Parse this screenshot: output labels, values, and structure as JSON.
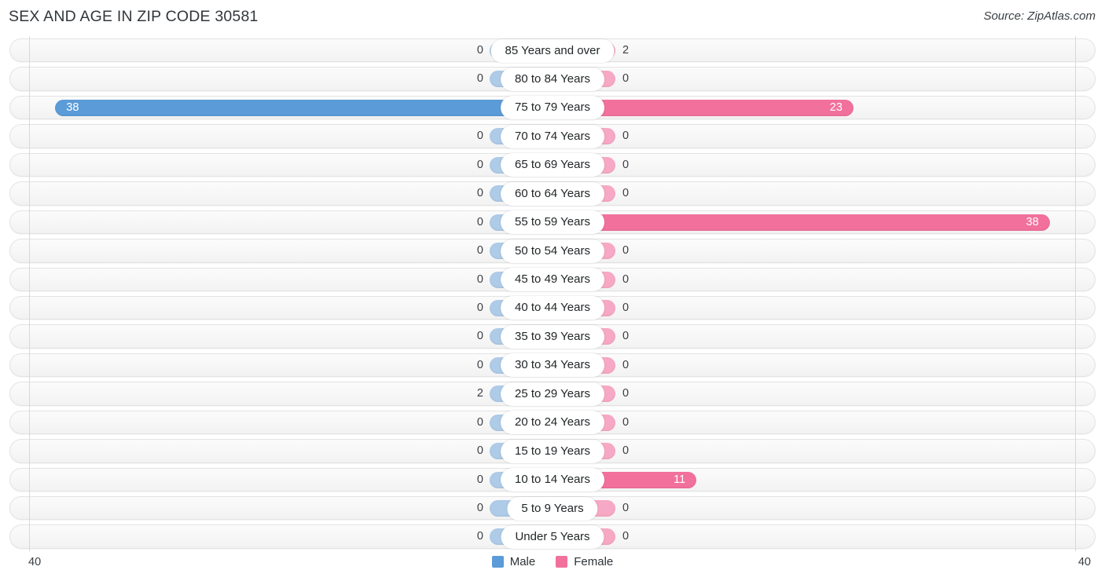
{
  "header": {
    "title": "SEX AND AGE IN ZIP CODE 30581",
    "source": "Source: ZipAtlas.com"
  },
  "legend": {
    "male_label": "Male",
    "female_label": "Female",
    "male_color": "#5b9bd8",
    "female_color": "#f2709c",
    "male_color_light": "#aecbe8",
    "female_color_light": "#f7a8c4"
  },
  "axis": {
    "left_label": "40",
    "right_label": "40",
    "max": 40
  },
  "chart_data": {
    "type": "bar",
    "subtype": "population-pyramid",
    "title": "SEX AND AGE IN ZIP CODE 30581",
    "xlabel": "",
    "ylabel": "",
    "xlim": [
      40,
      40
    ],
    "grid": false,
    "legend_position": "bottom-center",
    "categories": [
      "85 Years and over",
      "80 to 84 Years",
      "75 to 79 Years",
      "70 to 74 Years",
      "65 to 69 Years",
      "60 to 64 Years",
      "55 to 59 Years",
      "50 to 54 Years",
      "45 to 49 Years",
      "40 to 44 Years",
      "35 to 39 Years",
      "30 to 34 Years",
      "25 to 29 Years",
      "20 to 24 Years",
      "15 to 19 Years",
      "10 to 14 Years",
      "5 to 9 Years",
      "Under 5 Years"
    ],
    "series": [
      {
        "name": "Male",
        "values": [
          0,
          0,
          38,
          0,
          0,
          0,
          0,
          0,
          0,
          0,
          0,
          0,
          2,
          0,
          0,
          0,
          0,
          0
        ]
      },
      {
        "name": "Female",
        "values": [
          2,
          0,
          23,
          0,
          0,
          0,
          38,
          0,
          0,
          0,
          0,
          0,
          0,
          0,
          0,
          11,
          0,
          0
        ]
      }
    ]
  },
  "rows": [
    {
      "category": "85 Years and over",
      "male": "0",
      "female": "2"
    },
    {
      "category": "80 to 84 Years",
      "male": "0",
      "female": "0"
    },
    {
      "category": "75 to 79 Years",
      "male": "38",
      "female": "23"
    },
    {
      "category": "70 to 74 Years",
      "male": "0",
      "female": "0"
    },
    {
      "category": "65 to 69 Years",
      "male": "0",
      "female": "0"
    },
    {
      "category": "60 to 64 Years",
      "male": "0",
      "female": "0"
    },
    {
      "category": "55 to 59 Years",
      "male": "0",
      "female": "38"
    },
    {
      "category": "50 to 54 Years",
      "male": "0",
      "female": "0"
    },
    {
      "category": "45 to 49 Years",
      "male": "0",
      "female": "0"
    },
    {
      "category": "40 to 44 Years",
      "male": "0",
      "female": "0"
    },
    {
      "category": "35 to 39 Years",
      "male": "0",
      "female": "0"
    },
    {
      "category": "30 to 34 Years",
      "male": "0",
      "female": "0"
    },
    {
      "category": "25 to 29 Years",
      "male": "2",
      "female": "0"
    },
    {
      "category": "20 to 24 Years",
      "male": "0",
      "female": "0"
    },
    {
      "category": "15 to 19 Years",
      "male": "0",
      "female": "0"
    },
    {
      "category": "10 to 14 Years",
      "male": "0",
      "female": "11"
    },
    {
      "category": "5 to 9 Years",
      "male": "0",
      "female": "0"
    },
    {
      "category": "Under 5 Years",
      "male": "0",
      "female": "0"
    }
  ]
}
